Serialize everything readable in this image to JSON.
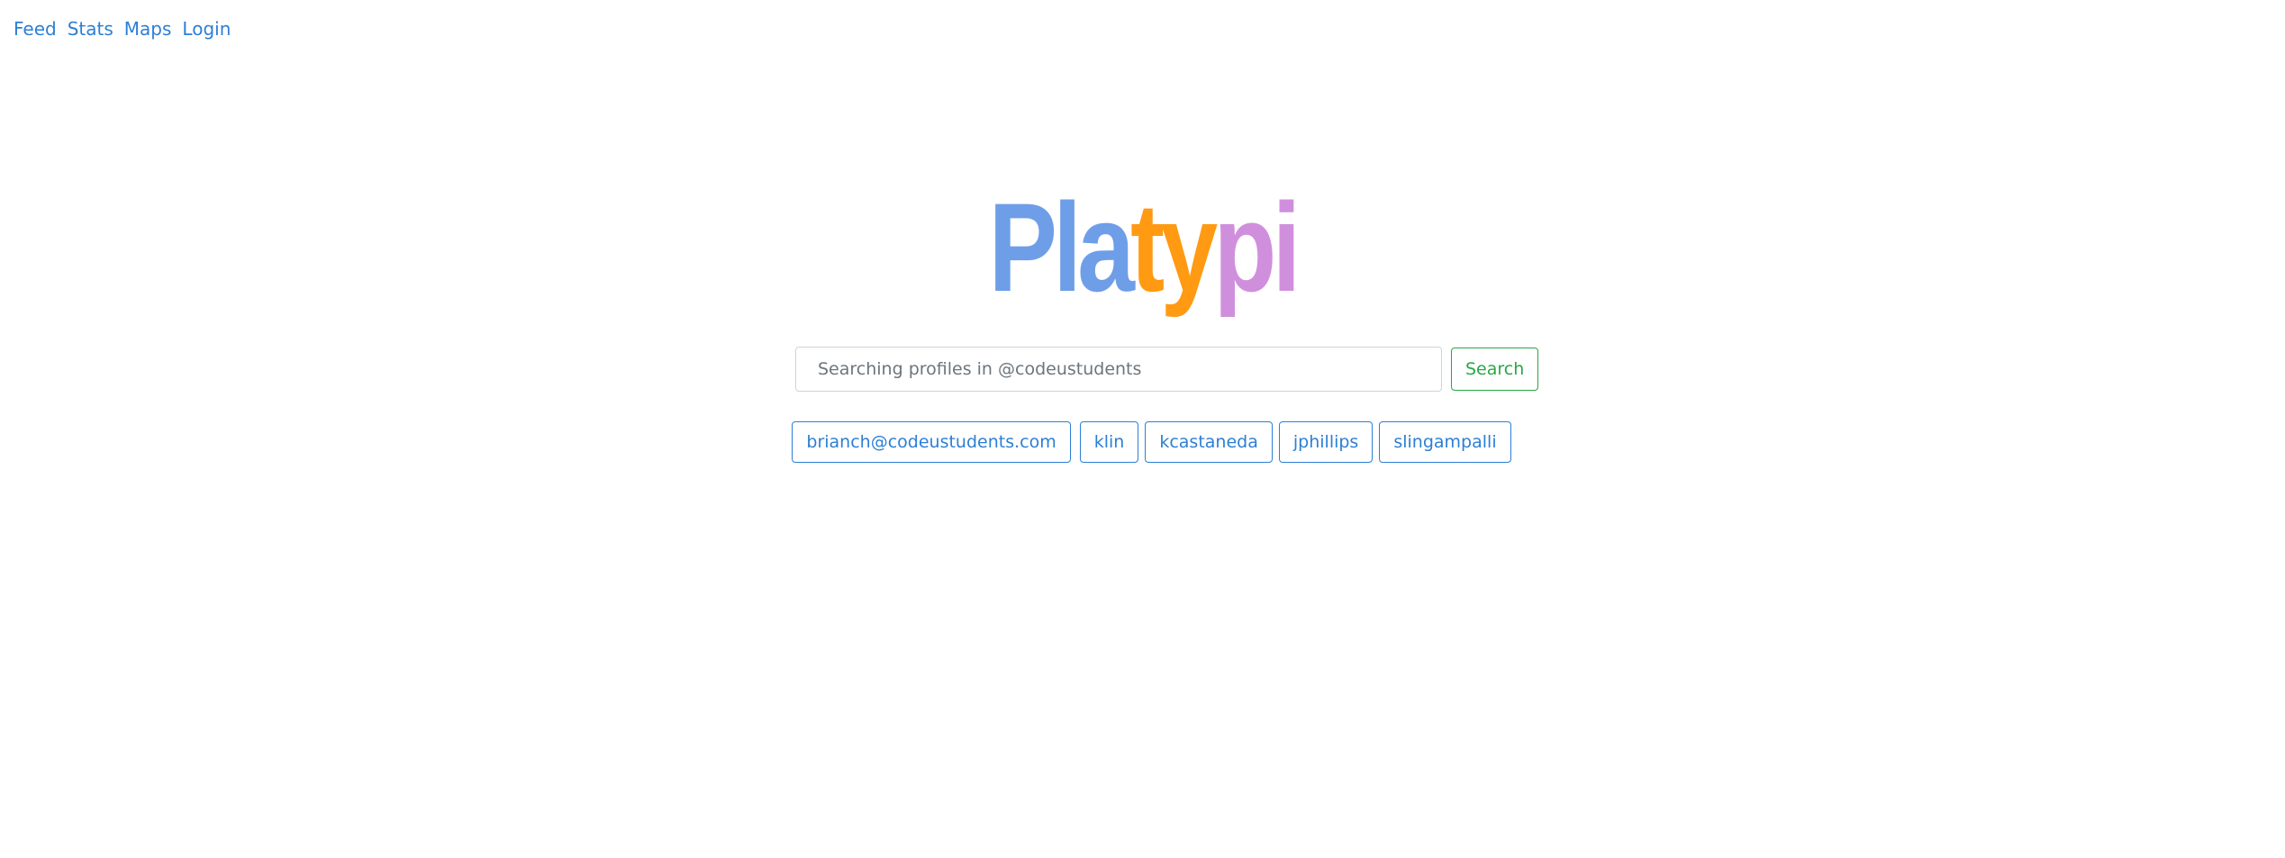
{
  "nav": {
    "items": [
      {
        "label": "Feed"
      },
      {
        "label": "Stats"
      },
      {
        "label": "Maps"
      },
      {
        "label": "Login"
      }
    ]
  },
  "logo": {
    "letters": [
      {
        "char": "P",
        "color": "#6f9ee8"
      },
      {
        "char": "l",
        "color": "#6f9ee8"
      },
      {
        "char": "a",
        "color": "#6f9ee8"
      },
      {
        "char": "t",
        "color": "#ff9a12"
      },
      {
        "char": "y",
        "color": "#ff9a12"
      },
      {
        "char": "p",
        "color": "#d08fdc"
      },
      {
        "char": "i",
        "color": "#d08fdc"
      }
    ]
  },
  "search": {
    "placeholder": "Searching profiles in @codeustudents",
    "value": "",
    "button_label": "Search"
  },
  "suggestions": [
    {
      "label": "brianch@codeustudents.com"
    },
    {
      "label": "klin"
    },
    {
      "label": "kcastaneda"
    },
    {
      "label": "jphillips"
    },
    {
      "label": "slingampalli"
    }
  ],
  "colors": {
    "link": "#2c7fd6",
    "success": "#28a745"
  }
}
